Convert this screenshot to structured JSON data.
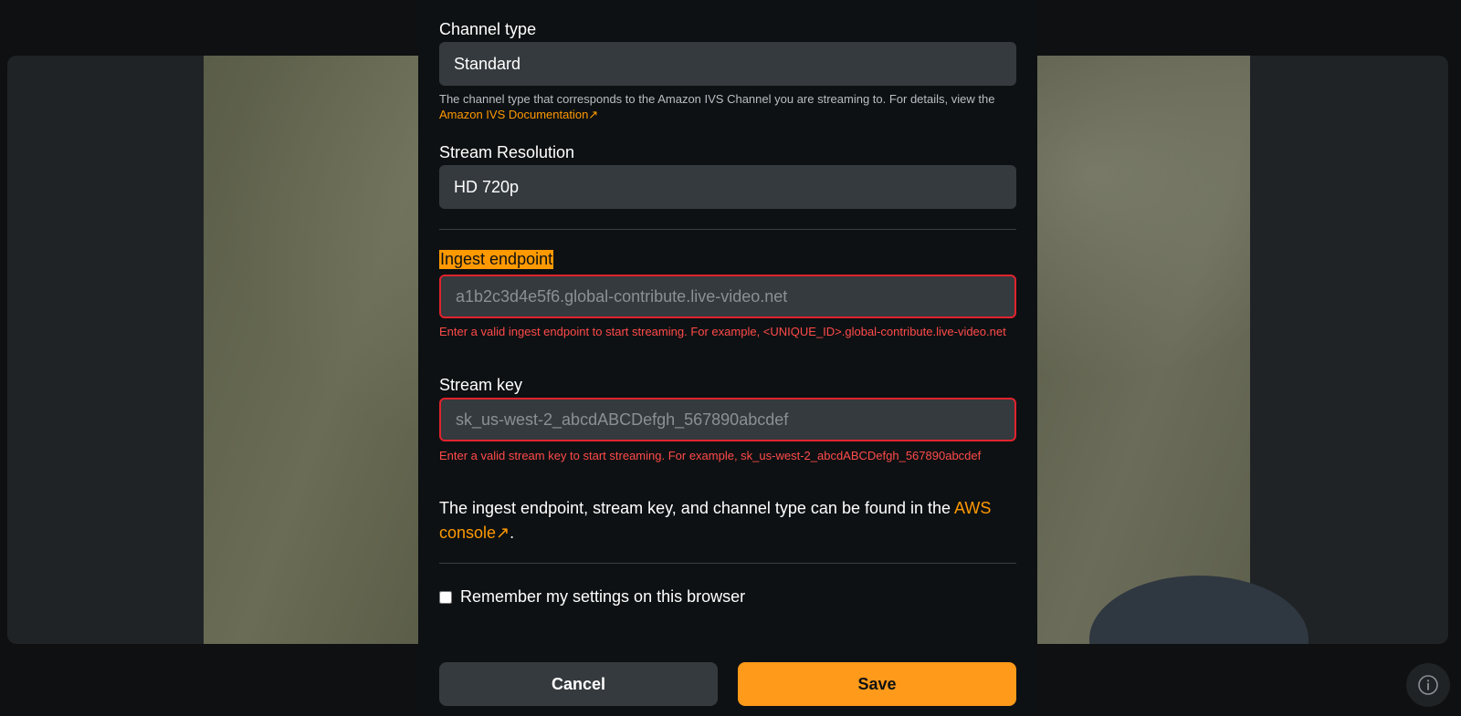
{
  "form": {
    "channel_type": {
      "label": "Channel type",
      "value": "Standard",
      "hint_prefix": "The channel type that corresponds to the Amazon IVS Channel you are streaming to. For details, view the ",
      "hint_link": "Amazon IVS Documentation↗"
    },
    "resolution": {
      "label": "Stream Resolution",
      "value": "HD 720p"
    },
    "ingest": {
      "label": "Ingest endpoint",
      "placeholder": "a1b2c3d4e5f6.global-contribute.live-video.net",
      "value": "",
      "error": "Enter a valid ingest endpoint to start streaming. For example, <UNIQUE_ID>.global-contribute.live-video.net"
    },
    "stream_key": {
      "label": "Stream key",
      "placeholder": "sk_us-west-2_abcdABCDefgh_567890abcdef",
      "value": "",
      "error": "Enter a valid stream key to start streaming. For example, sk_us-west-2_abcdABCDefgh_567890abcdef"
    },
    "info": {
      "prefix": "The ingest endpoint, stream key, and channel type can be found in the ",
      "link": "AWS console↗",
      "suffix": "."
    },
    "remember_label": "Remember my settings on this browser",
    "remember_checked": false
  },
  "buttons": {
    "cancel": "Cancel",
    "save": "Save"
  },
  "icons": {
    "info": "info-circle-icon",
    "external_link": "arrow-up-right-icon"
  },
  "colors": {
    "accent": "#ff9900",
    "error": "#e0232d",
    "panel_bg": "#0e1113",
    "field_bg": "#353a3e"
  }
}
